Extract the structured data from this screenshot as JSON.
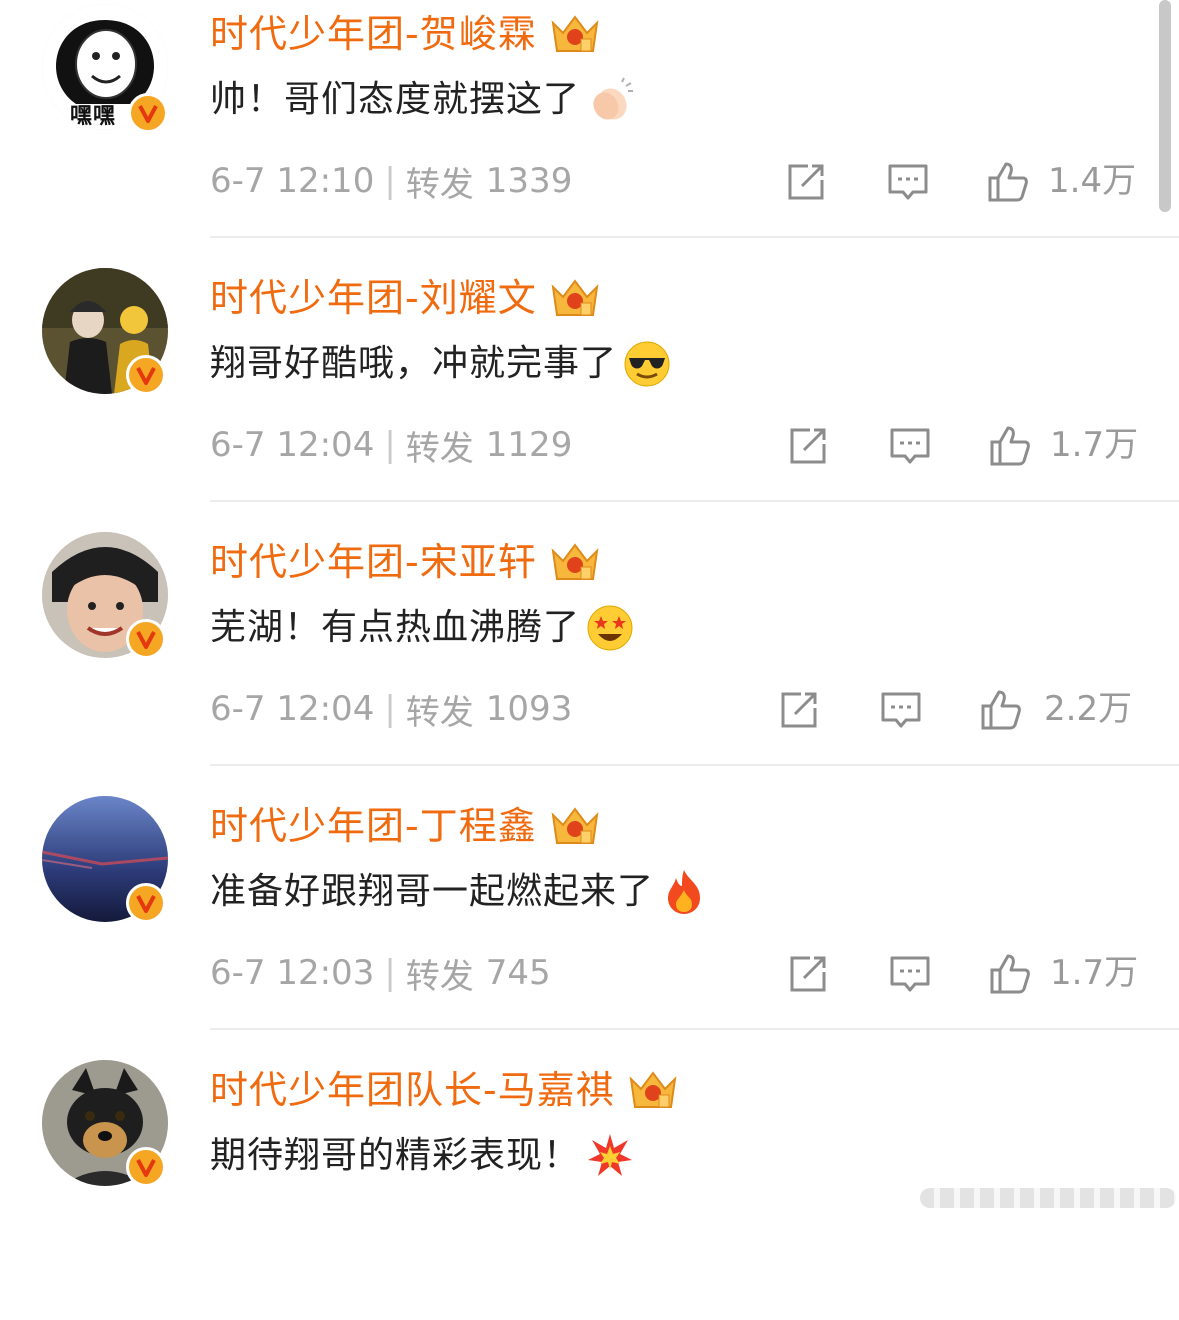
{
  "comments": [
    {
      "name": "时代少年团-贺峻霖",
      "text": "帅！哥们态度就摆这了",
      "emoji": "clapping-hands-icon",
      "time": "6-7 12:10",
      "separator": "|",
      "repost_label": "转发",
      "repost_count": "1339",
      "like_count": "1.4万",
      "avatar_label": "嘿嘿"
    },
    {
      "name": "时代少年团-刘耀文",
      "text": "翔哥好酷哦，冲就完事了",
      "emoji": "sunglasses-face-icon",
      "time": "6-7 12:04",
      "separator": "|",
      "repost_label": "转发",
      "repost_count": "1129",
      "like_count": "1.7万"
    },
    {
      "name": "时代少年团-宋亚轩",
      "text": "芜湖！有点热血沸腾了",
      "emoji": "star-struck-face-icon",
      "time": "6-7 12:04",
      "separator": "|",
      "repost_label": "转发",
      "repost_count": "1093",
      "like_count": "2.2万"
    },
    {
      "name": "时代少年团-丁程鑫",
      "text": "准备好跟翔哥一起燃起来了",
      "emoji": "fire-icon",
      "time": "6-7 12:03",
      "separator": "|",
      "repost_label": "转发",
      "repost_count": "745",
      "like_count": "1.7万"
    },
    {
      "name": "时代少年团队长-马嘉祺",
      "text": "期待翔哥的精彩表现！",
      "emoji": "collision-icon"
    }
  ],
  "colors": {
    "name": "#f06a0f",
    "text": "#222222",
    "meta": "#a6a6a6",
    "badge": "#f5a623"
  }
}
